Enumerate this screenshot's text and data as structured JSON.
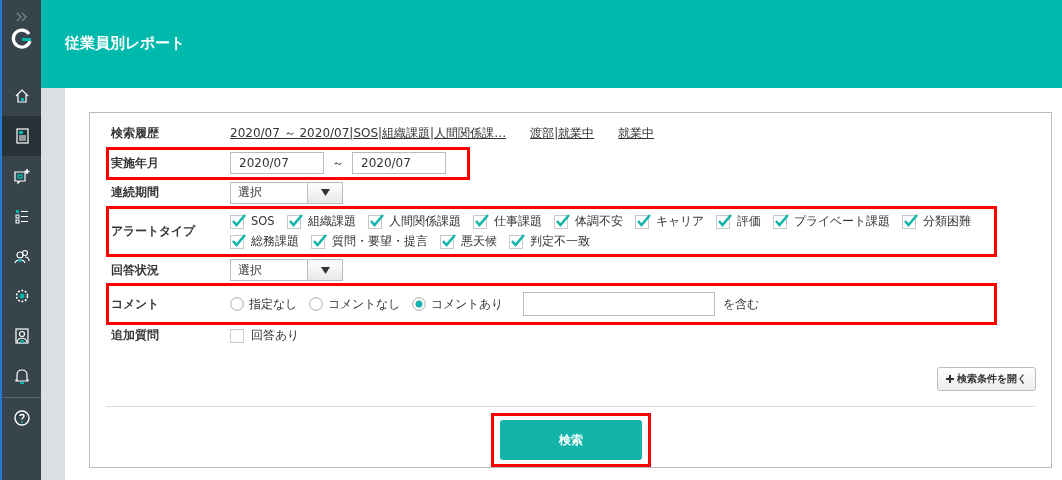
{
  "sidebar": {
    "items": [
      {
        "kind": "home",
        "selected": false
      },
      {
        "kind": "report",
        "selected": true
      },
      {
        "kind": "chat-add",
        "selected": false
      },
      {
        "kind": "checklist",
        "selected": false
      },
      {
        "kind": "people",
        "selected": false
      },
      {
        "kind": "gear",
        "selected": false
      },
      {
        "kind": "portrait",
        "selected": false
      },
      {
        "kind": "bell",
        "selected": false
      },
      {
        "kind": "help",
        "selected": false
      }
    ]
  },
  "header": {
    "title": "従業員別レポート"
  },
  "form": {
    "rows": [
      {
        "kind": "links",
        "label": "検索履歴",
        "highlighted": false,
        "links": [
          "2020/07 ～ 2020/07|SOS|組織課題|人間関係課…",
          "渡部|就業中",
          "就業中"
        ]
      },
      {
        "kind": "date_range",
        "label": "実施年月",
        "highlighted": true,
        "from": "2020/07",
        "separator": "～",
        "to": "2020/07"
      },
      {
        "kind": "select",
        "label": "連続期間",
        "highlighted": false,
        "value": "選択"
      },
      {
        "kind": "checkboxes",
        "label": "アラートタイプ",
        "highlighted": true,
        "options": [
          {
            "label": "SOS",
            "checked": true
          },
          {
            "label": "組織課題",
            "checked": true
          },
          {
            "label": "人間関係課題",
            "checked": true
          },
          {
            "label": "仕事課題",
            "checked": true
          },
          {
            "label": "体調不安",
            "checked": true
          },
          {
            "label": "キャリア",
            "checked": true
          },
          {
            "label": "評価",
            "checked": true
          },
          {
            "label": "プライベート課題",
            "checked": true
          },
          {
            "label": "分類困難",
            "checked": true
          },
          {
            "label": "総務課題",
            "checked": true
          },
          {
            "label": "質問・要望・提言",
            "checked": true
          },
          {
            "label": "悪天候",
            "checked": true
          },
          {
            "label": "判定不一致",
            "checked": true
          }
        ]
      },
      {
        "kind": "select",
        "label": "回答状況",
        "highlighted": false,
        "value": "選択"
      },
      {
        "kind": "radios",
        "label": "コメント",
        "highlighted": true,
        "options": [
          {
            "label": "指定なし",
            "selected": false
          },
          {
            "label": "コメントなし",
            "selected": false
          },
          {
            "label": "コメントあり",
            "selected": true
          }
        ],
        "suffix": "を含む"
      },
      {
        "kind": "checkbox",
        "label": "追加質問",
        "highlighted": false,
        "option": {
          "label": "回答あり",
          "checked": false
        }
      }
    ],
    "expand_button": "検索条件を開く",
    "search_button": {
      "label": "検索",
      "highlighted": true
    }
  }
}
